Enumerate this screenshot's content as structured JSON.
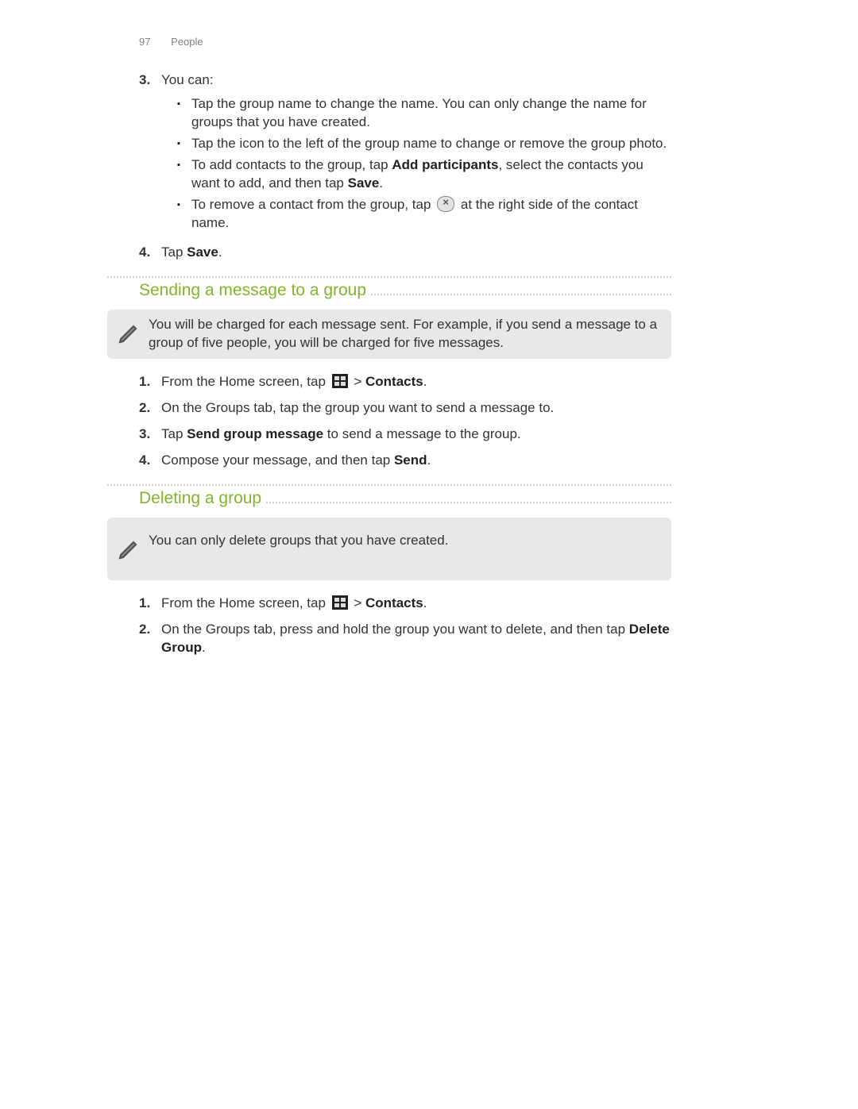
{
  "page_header": {
    "page_no": "97",
    "section": "People"
  },
  "list1": {
    "start": 3,
    "items": [
      {
        "num": "3.",
        "lead": "You can:",
        "bullets": [
          "Tap the group name to change the name. You can only change the name for groups that you have created.",
          "Tap the icon to the left of the group name to change or remove the group photo.",
          {
            "pre": "To add contacts to the group, tap ",
            "b1": "Add participants",
            "mid": ", select the contacts you want to add, and then tap ",
            "b2": "Save",
            "post": "."
          },
          {
            "pre": "To remove a contact from the group, tap ",
            "icon": "x",
            "post": " at the right side of the contact name."
          }
        ]
      },
      {
        "num": "4.",
        "text_pre": "Tap ",
        "text_bold": "Save",
        "text_post": "."
      }
    ]
  },
  "section2": {
    "heading": "Sending a message to a group",
    "note": "You will be charged for each message sent. For example, if you send a message to a group of five people, you will be charged for five messages.",
    "steps": [
      {
        "num": "1.",
        "pre": "From the Home screen, tap ",
        "icon": "apps",
        "mid": " > ",
        "bold": "Contacts",
        "post": "."
      },
      {
        "num": "2.",
        "text": "On the Groups tab, tap the group you want to send a message to."
      },
      {
        "num": "3.",
        "pre": "Tap ",
        "bold": "Send group message",
        "post": " to send a message to the group."
      },
      {
        "num": "4.",
        "pre": "Compose your message, and then tap ",
        "bold": "Send",
        "post": "."
      }
    ]
  },
  "section3": {
    "heading": "Deleting a group",
    "note": "You can only delete groups that you have created.",
    "steps": [
      {
        "num": "1.",
        "pre": "From the Home screen, tap ",
        "icon": "apps",
        "mid": " > ",
        "bold": "Contacts",
        "post": "."
      },
      {
        "num": "2.",
        "pre": "On the Groups tab, press and hold the group you want to delete, and then tap ",
        "bold": "Delete Group",
        "post": "."
      }
    ]
  }
}
